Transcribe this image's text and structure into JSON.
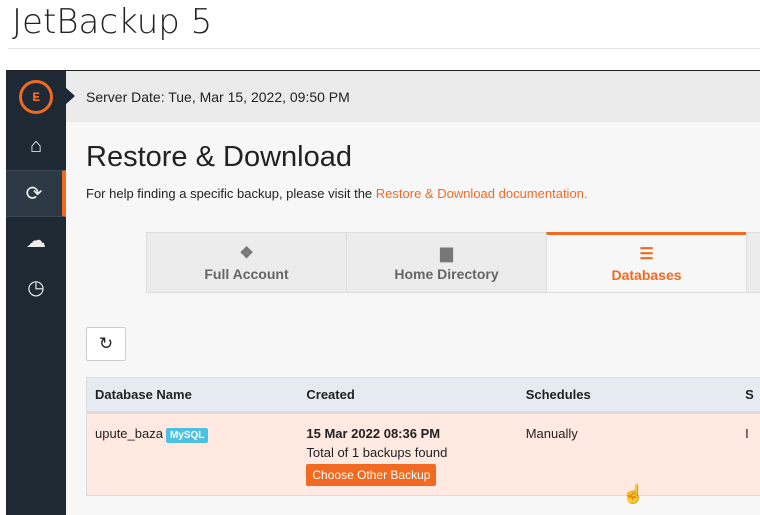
{
  "app_title": "JetBackup 5",
  "server_date": "Server Date: Tue, Mar 15, 2022, 09:50 PM",
  "sidebar": {
    "items": [
      {
        "icon": "home-icon",
        "glyph": "⌂"
      },
      {
        "icon": "sync-icon",
        "glyph": "⟳",
        "active": true
      },
      {
        "icon": "cloud-download-icon",
        "glyph": "☁"
      },
      {
        "icon": "clock-icon",
        "glyph": "◷"
      }
    ]
  },
  "page": {
    "title": "Restore & Download",
    "help_text": "For help finding a specific backup, please visit the ",
    "help_link": "Restore & Download documentation."
  },
  "tabs": [
    {
      "label": "Full Account",
      "icon": "cubes-icon",
      "glyph": "❖"
    },
    {
      "label": "Home Directory",
      "icon": "folder-icon",
      "glyph": "▆"
    },
    {
      "label": "Databases",
      "icon": "database-icon",
      "glyph": "☰",
      "active": true
    }
  ],
  "accent": "#f26a21",
  "table": {
    "headers": [
      "Database Name",
      "Created",
      "Schedules",
      "S"
    ],
    "rows": [
      {
        "name": "upute_baza",
        "badge": "MySQL",
        "created": "15 Mar 2022 08:36 PM",
        "backups": "Total of 1 backups found",
        "action": "Choose Other Backup",
        "schedules": "Manually",
        "extra": "I"
      }
    ]
  }
}
